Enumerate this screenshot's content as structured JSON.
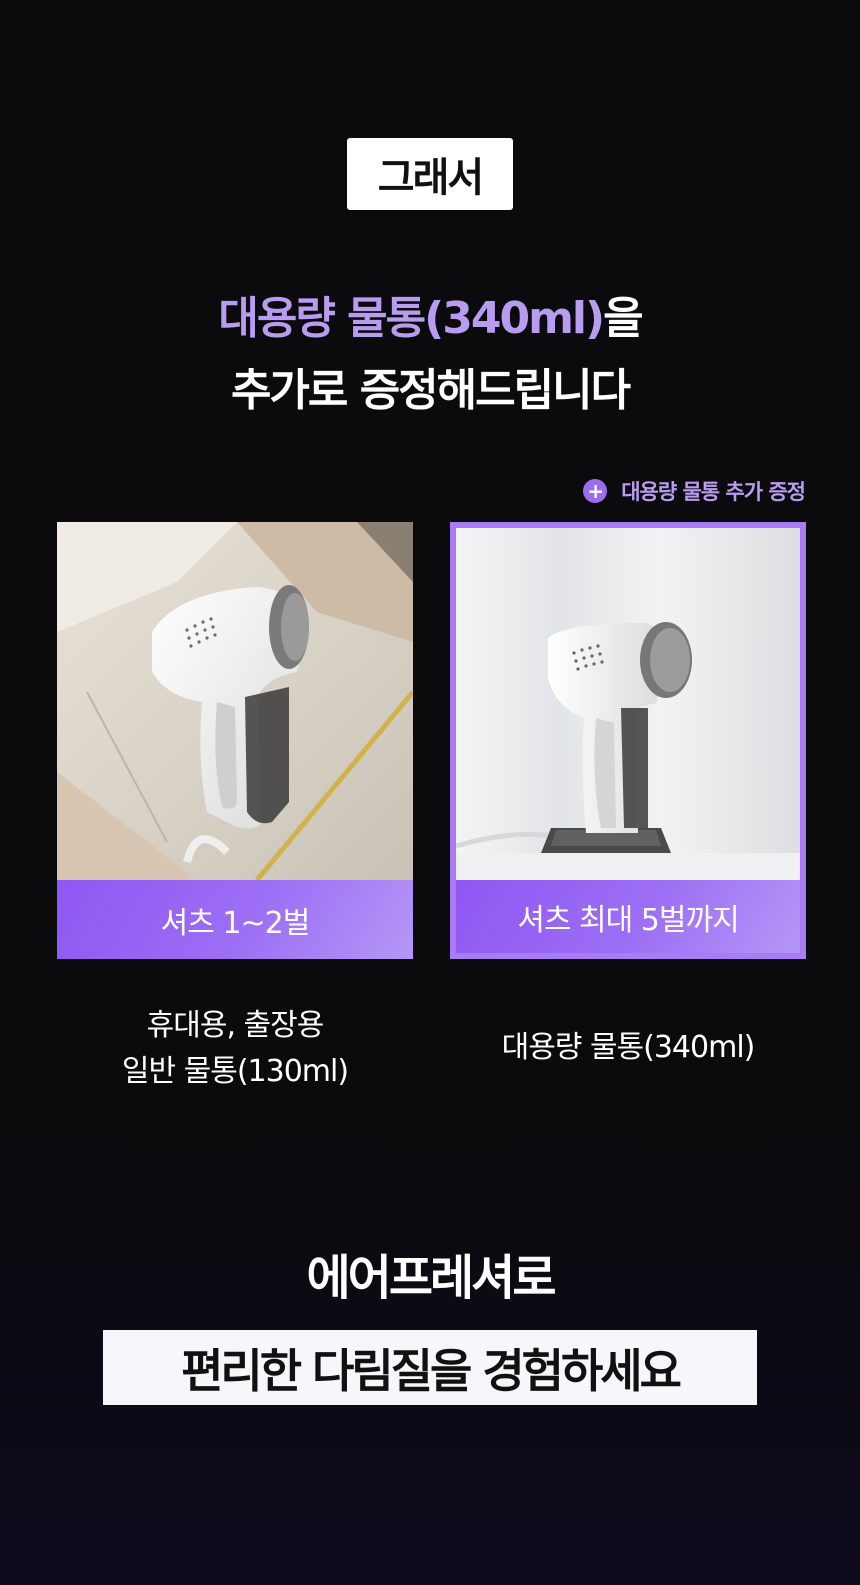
{
  "badge": "그래서",
  "headline": {
    "line1_accent": "대용량 물통(340ml)",
    "line1_rest": "을",
    "line2": "추가로 증정해드립니다"
  },
  "bonus_tag": {
    "icon": "plus-icon",
    "label": "대용량 물통 추가 증정"
  },
  "cards": [
    {
      "label": "셔츠 1~2벌",
      "caption_line1": "휴대용, 출장용",
      "caption_line2": "일반 물통(130ml)"
    },
    {
      "label": "셔츠 최대 5벌까지",
      "caption_line1": "대용량 물통(340ml)"
    }
  ],
  "footer": {
    "line1": "에어프레셔로",
    "line2": "편리한 다림질을 경험하세요"
  },
  "colors": {
    "accent": "#b89cf0",
    "card_purple": "#9d6ff4"
  }
}
